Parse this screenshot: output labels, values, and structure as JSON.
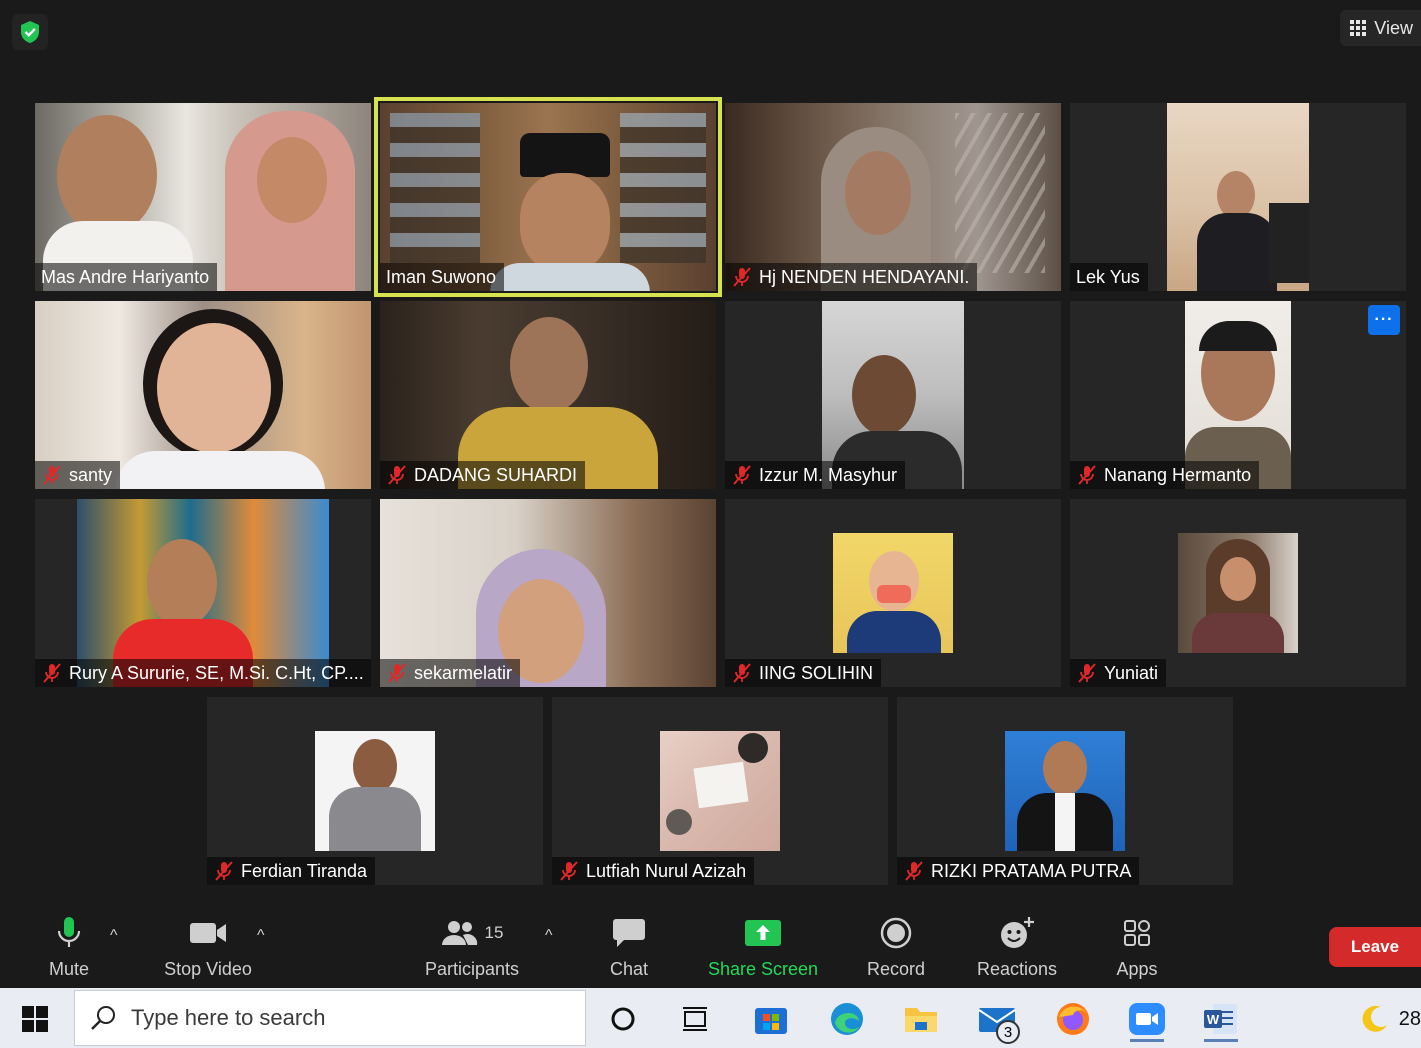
{
  "top": {
    "shield_icon": "shield-check-icon",
    "view_label": "View"
  },
  "participants": [
    {
      "name": "Mas Andre Hariyanto",
      "muted": false,
      "active": false
    },
    {
      "name": "Iman Suwono",
      "muted": false,
      "active": true
    },
    {
      "name": "Hj NENDEN HENDAYANI.",
      "muted": true,
      "active": false
    },
    {
      "name": "Lek Yus",
      "muted": false,
      "active": false
    },
    {
      "name": "santy",
      "muted": true,
      "active": false
    },
    {
      "name": "DADANG SUHARDI",
      "muted": true,
      "active": false
    },
    {
      "name": "Izzur M. Masyhur",
      "muted": true,
      "active": false
    },
    {
      "name": "Nanang Hermanto",
      "muted": true,
      "active": false,
      "more_label": "···"
    },
    {
      "name": "Rury A Sururie, SE, M.Si. C.Ht, CP....",
      "muted": true,
      "active": false
    },
    {
      "name": "sekarmelatir",
      "muted": true,
      "active": false
    },
    {
      "name": "IING SOLIHIN",
      "muted": true,
      "active": false
    },
    {
      "name": "Yuniati",
      "muted": true,
      "active": false
    },
    {
      "name": "Ferdian Tiranda",
      "muted": true,
      "active": false
    },
    {
      "name": "Lutfiah Nurul Azizah",
      "muted": true,
      "active": false
    },
    {
      "name": "RIZKI PRATAMA PUTRA",
      "muted": true,
      "active": false
    }
  ],
  "toolbar": {
    "mute_label": "Mute",
    "stop_video_label": "Stop Video",
    "participants_label": "Participants",
    "participants_count": "15",
    "chat_label": "Chat",
    "share_screen_label": "Share Screen",
    "record_label": "Record",
    "reactions_label": "Reactions",
    "apps_label": "Apps",
    "leave_label": "Leave",
    "caret": "^"
  },
  "taskbar": {
    "search_placeholder": "Type here to search",
    "mail_badge": "3",
    "clock_partial": "28",
    "colors": {
      "accent_green": "#23d959",
      "leave_red": "#d52a2a",
      "active_border": "#d6e34f",
      "more_blue": "#0e71eb"
    }
  }
}
